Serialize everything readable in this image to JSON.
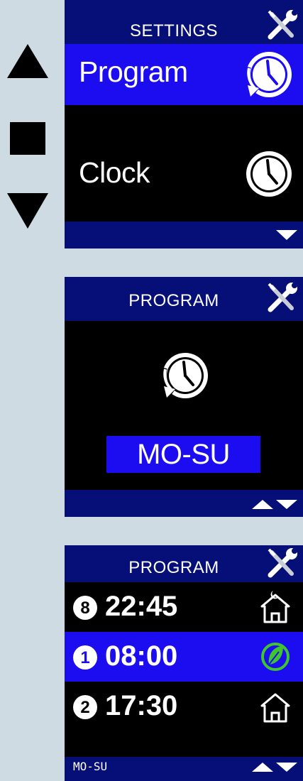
{
  "nav": {
    "up_icon": "triangle-up",
    "ok_icon": "square",
    "down_icon": "triangle-down"
  },
  "screen1": {
    "title": "SETTINGS",
    "header_icon": "wrench-screwdriver-icon",
    "items": [
      {
        "label": "Program",
        "icon": "clock-cycle-icon",
        "selected": true
      },
      {
        "label": "Clock",
        "icon": "clock-icon",
        "selected": false
      }
    ],
    "footer_arrows": "down"
  },
  "screen2": {
    "title": "PROGRAM",
    "header_icon": "wrench-screwdriver-icon",
    "icon": "clock-cycle-icon",
    "day_range": "MO-SU",
    "footer_arrows": "up-down"
  },
  "screen3": {
    "title": "PROGRAM",
    "header_icon": "wrench-screwdriver-icon",
    "entries": [
      {
        "number": "8",
        "time": "22:45",
        "mode_icon": "night-house-icon",
        "selected": false
      },
      {
        "number": "1",
        "time": "08:00",
        "mode_icon": "eco-leaf-icon",
        "selected": true
      },
      {
        "number": "2",
        "time": "17:30",
        "mode_icon": "house-icon",
        "selected": false
      }
    ],
    "footer_label": "MO-SU",
    "footer_arrows": "up-down"
  },
  "colors": {
    "background": "#cfdbe2",
    "header": "#060f77",
    "selected": "#1c0df0",
    "eco_green": "#3ec62a"
  }
}
